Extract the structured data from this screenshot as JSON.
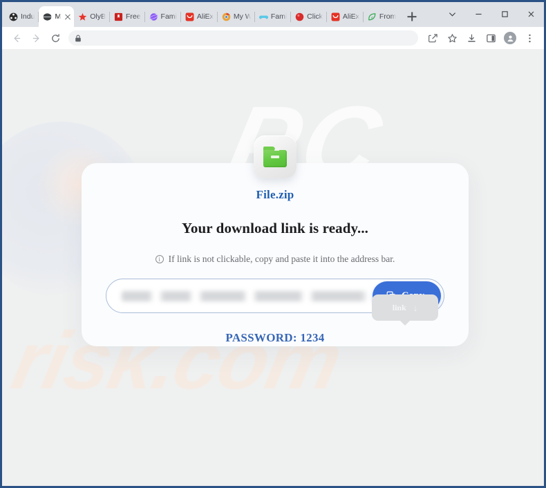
{
  "browser": {
    "tabs": [
      {
        "title": "Indu",
        "favicon": "film-reel-icon",
        "color": "#2b2b2b",
        "active": false
      },
      {
        "title": "M",
        "favicon": "globe-icon",
        "color": "#3c4043",
        "active": true
      },
      {
        "title": "OlyB",
        "favicon": "star-icon",
        "color": "#e8352c",
        "active": false
      },
      {
        "title": "Free",
        "favicon": "document-icon",
        "color": "#c9211e",
        "active": false
      },
      {
        "title": "Fami",
        "favicon": "planet-icon",
        "color": "#8b5cf6",
        "active": false
      },
      {
        "title": "AliEx",
        "favicon": "aliexpress-icon",
        "color": "#e43225",
        "active": false
      },
      {
        "title": "My W",
        "favicon": "chrome-icon",
        "color": "#d98b2b",
        "active": false
      },
      {
        "title": "Fami",
        "favicon": "gamepad-icon",
        "color": "#5bc8e8",
        "active": false
      },
      {
        "title": "Click",
        "favicon": "red-circle-icon",
        "color": "#d92b2b",
        "active": false
      },
      {
        "title": "AliEx",
        "favicon": "aliexpress-icon",
        "color": "#e43225",
        "active": false
      },
      {
        "title": "From",
        "favicon": "e-leaf-icon",
        "color": "#2fa84f",
        "active": false
      }
    ],
    "new_tab_label": "+",
    "window_controls": {
      "tab_search": "tab-search-chevron",
      "minimize": "minimize",
      "maximize": "maximize",
      "close": "close"
    },
    "toolbar": {
      "back": "back",
      "forward": "forward",
      "reload": "reload",
      "omnibox_value": "",
      "omnibox_placeholder": "",
      "lock_icon": "lock-icon",
      "share": "share-icon",
      "bookmark": "star-outline-icon",
      "downloads": "download-icon",
      "side_panel": "side-panel-icon",
      "profile": "profile-avatar-icon",
      "menu": "three-dot-menu-icon"
    }
  },
  "page": {
    "watermark_top": "PC",
    "watermark_bottom": "risk.com",
    "file_icon": "zip-folder-icon",
    "filename": "File.zip",
    "headline": "Your download link is ready...",
    "hint": {
      "icon": "info-circle-icon",
      "text": "If link is not clickable, copy and paste it into the address bar."
    },
    "link_input": {
      "value": "",
      "placeholder": "",
      "state": "blurred"
    },
    "copy_button": {
      "label": "Copy",
      "icon": "copy-icon"
    },
    "password": "PASSWORD: 1234",
    "tooltip": {
      "label": "link",
      "icon": "download-arrow-icon"
    },
    "colors": {
      "accent_blue": "#3a6fd8",
      "filename_blue": "#1f5fb0",
      "password_blue": "#3767b6",
      "card_bg": "#fbfcfe",
      "page_bg": "#eff0f0",
      "frame_border": "#2b5286",
      "zip_green": "#63c842"
    }
  }
}
